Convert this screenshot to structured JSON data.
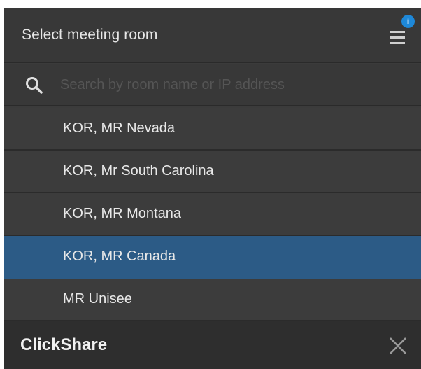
{
  "header": {
    "title": "Select meeting room",
    "menu_icon": "hamburger-menu-icon",
    "badge_text": "i"
  },
  "search": {
    "icon": "search-icon",
    "placeholder": "Search by room name or IP address",
    "value": ""
  },
  "rooms": [
    {
      "label": "KOR, MR Nevada",
      "selected": false
    },
    {
      "label": "KOR, Mr South Carolina",
      "selected": false
    },
    {
      "label": "KOR, MR Montana",
      "selected": false
    },
    {
      "label": "KOR, MR Canada",
      "selected": true
    },
    {
      "label": "MR Unisee",
      "selected": false
    }
  ],
  "footer": {
    "brand": "ClickShare",
    "close_icon": "close-icon"
  },
  "colors": {
    "panel_bg": "#3b3b3b",
    "selected_bg": "#2c5b86",
    "badge": "#1e88d8",
    "footer_bg": "#2e2e2e",
    "text": "#e8e8e8"
  }
}
